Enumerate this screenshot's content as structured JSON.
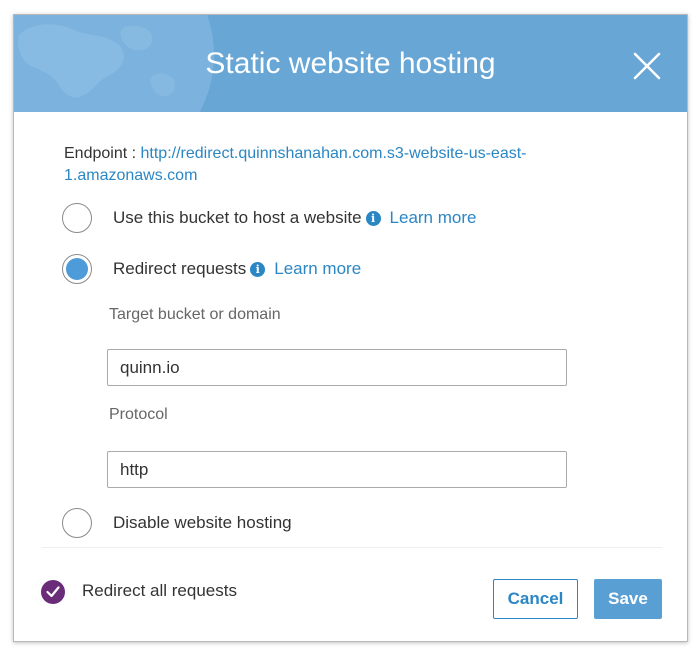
{
  "dialog": {
    "title": "Static website hosting",
    "close_icon": "close-icon"
  },
  "endpoint": {
    "label": "Endpoint :",
    "url": "http://redirect.quinnshanahan.com.s3-website-us-east-1.amazonaws.com"
  },
  "options": {
    "host": {
      "label": "Use this bucket to host a website",
      "learn_more": "Learn more",
      "checked": false
    },
    "redirect": {
      "label": "Redirect requests",
      "learn_more": "Learn more",
      "checked": true
    },
    "disable": {
      "label": "Disable website hosting",
      "checked": false
    }
  },
  "redirect_form": {
    "target_label": "Target bucket or domain",
    "target_value": "quinn.io",
    "protocol_label": "Protocol",
    "protocol_value": "http"
  },
  "footer": {
    "summary_label": "Redirect all requests",
    "cancel_label": "Cancel",
    "save_label": "Save"
  },
  "colors": {
    "header_bg": "#68a6d6",
    "link": "#2b86c4",
    "radio_checked": "#4d9bd8",
    "check_badge": "#6a2c79",
    "save_button": "#5a9fd4"
  }
}
